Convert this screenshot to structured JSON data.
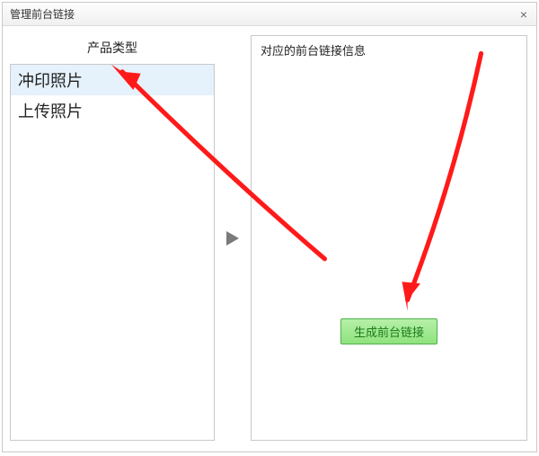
{
  "dialog": {
    "title": "管理前台链接",
    "close_glyph": "×"
  },
  "left": {
    "header": "产品类型",
    "items": [
      {
        "label": "冲印照片",
        "selected": true
      },
      {
        "label": "上传照片",
        "selected": false
      }
    ]
  },
  "mid": {
    "arrow_name": "play-icon"
  },
  "right": {
    "header": "对应的前台链接信息",
    "generate_button": "生成前台链接"
  }
}
